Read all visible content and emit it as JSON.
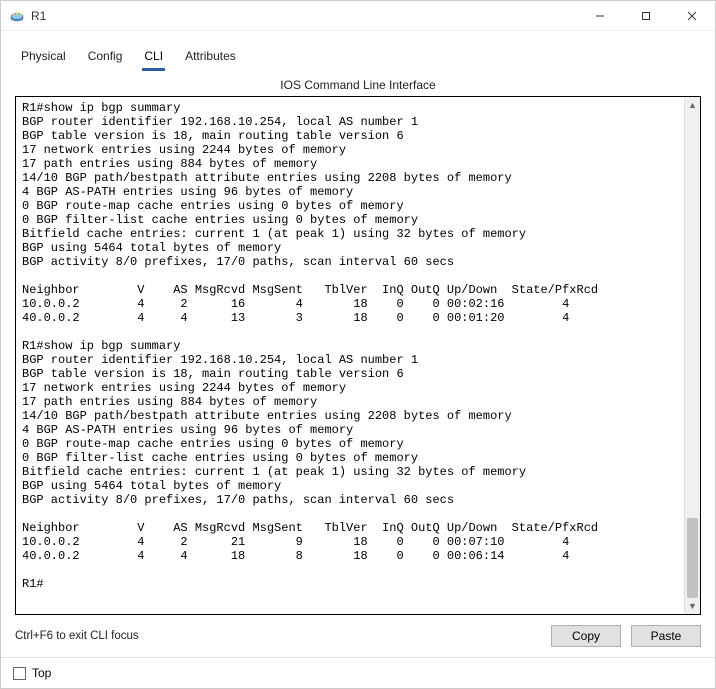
{
  "window": {
    "title": "R1"
  },
  "tabs": {
    "items": [
      {
        "label": "Physical"
      },
      {
        "label": "Config"
      },
      {
        "label": "CLI"
      },
      {
        "label": "Attributes"
      }
    ],
    "active_index": 2
  },
  "cli": {
    "heading": "IOS Command Line Interface",
    "hint": "Ctrl+F6 to exit CLI focus",
    "copy_label": "Copy",
    "paste_label": "Paste",
    "lines": [
      "R1#show ip bgp summary",
      "BGP router identifier 192.168.10.254, local AS number 1",
      "BGP table version is 18, main routing table version 6",
      "17 network entries using 2244 bytes of memory",
      "17 path entries using 884 bytes of memory",
      "14/10 BGP path/bestpath attribute entries using 2208 bytes of memory",
      "4 BGP AS-PATH entries using 96 bytes of memory",
      "0 BGP route-map cache entries using 0 bytes of memory",
      "0 BGP filter-list cache entries using 0 bytes of memory",
      "Bitfield cache entries: current 1 (at peak 1) using 32 bytes of memory",
      "BGP using 5464 total bytes of memory",
      "BGP activity 8/0 prefixes, 17/0 paths, scan interval 60 secs",
      "",
      "Neighbor        V    AS MsgRcvd MsgSent   TblVer  InQ OutQ Up/Down  State/PfxRcd",
      "10.0.0.2        4     2      16       4       18    0    0 00:02:16        4",
      "40.0.0.2        4     4      13       3       18    0    0 00:01:20        4",
      "",
      "R1#show ip bgp summary",
      "BGP router identifier 192.168.10.254, local AS number 1",
      "BGP table version is 18, main routing table version 6",
      "17 network entries using 2244 bytes of memory",
      "17 path entries using 884 bytes of memory",
      "14/10 BGP path/bestpath attribute entries using 2208 bytes of memory",
      "4 BGP AS-PATH entries using 96 bytes of memory",
      "0 BGP route-map cache entries using 0 bytes of memory",
      "0 BGP filter-list cache entries using 0 bytes of memory",
      "Bitfield cache entries: current 1 (at peak 1) using 32 bytes of memory",
      "BGP using 5464 total bytes of memory",
      "BGP activity 8/0 prefixes, 17/0 paths, scan interval 60 secs",
      "",
      "Neighbor        V    AS MsgRcvd MsgSent   TblVer  InQ OutQ Up/Down  State/PfxRcd",
      "10.0.0.2        4     2      21       9       18    0    0 00:07:10        4",
      "40.0.0.2        4     4      18       8       18    0    0 00:06:14        4",
      "",
      "R1#"
    ]
  },
  "footer": {
    "top_label": "Top",
    "top_checked": false
  }
}
